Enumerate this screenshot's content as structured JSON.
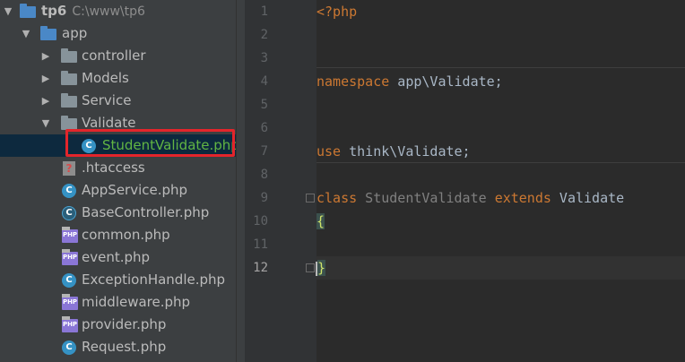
{
  "project": {
    "name": "tp6",
    "path": "C:\\www\\tp6",
    "tree": [
      {
        "label": "app",
        "icon": "folder-icon"
      },
      {
        "label": "controller",
        "icon": "folder-icon"
      },
      {
        "label": "Models",
        "icon": "folder-icon"
      },
      {
        "label": "Service",
        "icon": "folder-icon"
      },
      {
        "label": "Validate",
        "icon": "folder-icon"
      },
      {
        "label": "StudentValidate.php",
        "icon": "php-class-icon",
        "icon_letter": "C",
        "selected": true
      },
      {
        "label": ".htaccess",
        "icon": "htaccess-icon"
      },
      {
        "label": "AppService.php",
        "icon": "php-class-icon",
        "icon_letter": "C"
      },
      {
        "label": "BaseController.php",
        "icon": "abstract-class-icon",
        "icon_letter": "C"
      },
      {
        "label": "common.php",
        "icon": "php-file-icon",
        "icon_text": "PHP"
      },
      {
        "label": "event.php",
        "icon": "php-file-icon",
        "icon_text": "PHP"
      },
      {
        "label": "ExceptionHandle.php",
        "icon": "php-class-icon",
        "icon_letter": "C"
      },
      {
        "label": "middleware.php",
        "icon": "php-file-icon",
        "icon_text": "PHP"
      },
      {
        "label": "provider.php",
        "icon": "php-file-icon",
        "icon_text": "PHP"
      },
      {
        "label": "Request.php",
        "icon": "php-class-icon",
        "icon_letter": "C"
      }
    ]
  },
  "editor": {
    "line_numbers": [
      "1",
      "2",
      "3",
      "4",
      "5",
      "6",
      "7",
      "8",
      "9",
      "10",
      "11",
      "12"
    ],
    "current_line": "12",
    "code": {
      "l1": "<?php",
      "l4_kw": "namespace",
      "l4_rest": " app\\Validate;",
      "l7_kw": "use",
      "l7_rest": " think\\Validate;",
      "l9_kw1": "class",
      "l9_name": " StudentValidate ",
      "l9_kw2": "extends",
      "l9_parent": " Validate",
      "l10": "{",
      "l12": "}"
    }
  },
  "colors": {
    "keyword": "#cc7832",
    "class_name": "#808080",
    "text": "#a9b7c6",
    "selection_outline": "#e3252b"
  }
}
